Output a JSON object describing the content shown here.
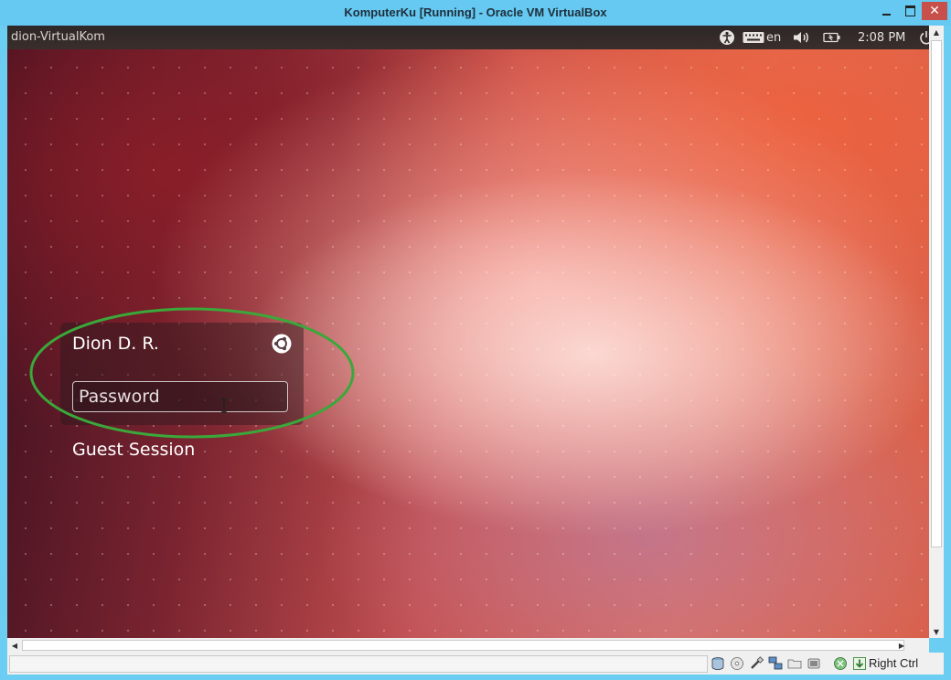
{
  "window": {
    "title": "KomputerKu [Running] - Oracle VM VirtualBox",
    "close_glyph": "✕"
  },
  "panel": {
    "hostname": "dion-VirtualKom",
    "language": "en",
    "time": "2:08 PM"
  },
  "login": {
    "user_name": "Dion D. R.",
    "password_placeholder": "Password",
    "password_value": "",
    "guest_session_label": "Guest Session"
  },
  "annotation": {
    "color": "#3aa83a"
  },
  "statusbar": {
    "host_key": "Right Ctrl",
    "icons": [
      "hard-disk-icon",
      "optical-drive-icon",
      "usb-icon",
      "network-icon",
      "shared-folders-icon",
      "video-capture-icon",
      "mouse-integration-icon",
      "host-key-arrow-icon"
    ]
  },
  "colors": {
    "titlebar": "#65c9f1",
    "close_button": "#c7504a",
    "panel": "#2d2727"
  }
}
